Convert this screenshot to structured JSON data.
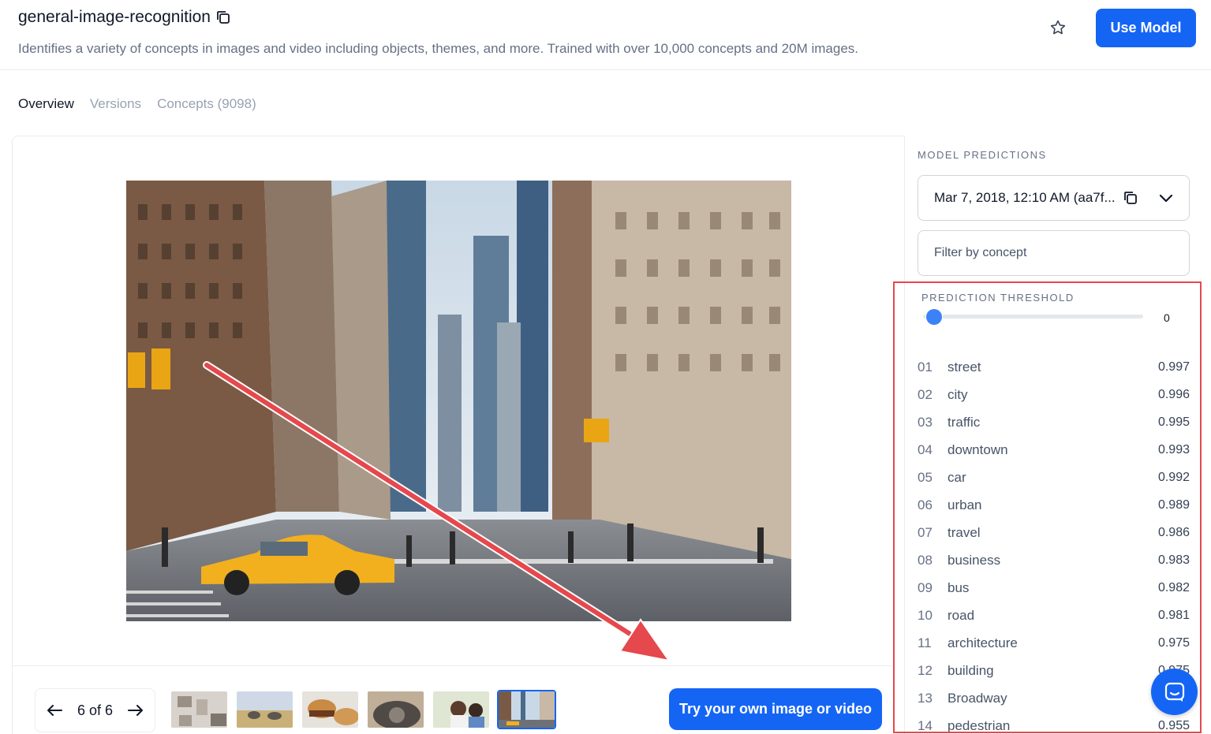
{
  "header": {
    "title": "general-image-recognition",
    "subtitle": "Identifies a variety of concepts in images and video including objects, themes, and more. Trained with over 10,000 concepts and 20M images.",
    "use_model_label": "Use Model"
  },
  "tabs": [
    {
      "label": "Overview",
      "active": true
    },
    {
      "label": "Versions",
      "active": false
    },
    {
      "label": "Concepts (9098)",
      "active": false
    }
  ],
  "gallery": {
    "pager_text": "6 of 6",
    "selected_thumb": 6,
    "thumb_count": 6,
    "try_label": "Try your own image or video"
  },
  "predictions": {
    "section_label": "MODEL PREDICTIONS",
    "version": "Mar 7, 2018, 12:10 AM (aa7f...",
    "filter_placeholder": "Filter by concept",
    "threshold_label": "PREDICTION THRESHOLD",
    "threshold_value": "0",
    "concepts": [
      {
        "num": "01",
        "name": "street",
        "value": "0.997"
      },
      {
        "num": "02",
        "name": "city",
        "value": "0.996"
      },
      {
        "num": "03",
        "name": "traffic",
        "value": "0.995"
      },
      {
        "num": "04",
        "name": "downtown",
        "value": "0.993"
      },
      {
        "num": "05",
        "name": "car",
        "value": "0.992"
      },
      {
        "num": "06",
        "name": "urban",
        "value": "0.989"
      },
      {
        "num": "07",
        "name": "travel",
        "value": "0.986"
      },
      {
        "num": "08",
        "name": "business",
        "value": "0.983"
      },
      {
        "num": "09",
        "name": "bus",
        "value": "0.982"
      },
      {
        "num": "10",
        "name": "road",
        "value": "0.981"
      },
      {
        "num": "11",
        "name": "architecture",
        "value": "0.975"
      },
      {
        "num": "12",
        "name": "building",
        "value": "0.975"
      },
      {
        "num": "13",
        "name": "Broadway",
        "value": ""
      },
      {
        "num": "14",
        "name": "pedestrian",
        "value": "0.955"
      }
    ]
  },
  "colors": {
    "primary": "#1565f5",
    "annotation_red": "#e5484d"
  }
}
